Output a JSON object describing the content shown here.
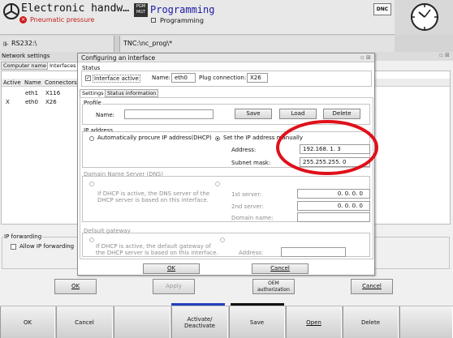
{
  "header": {
    "mode_title": "Electronic handw…",
    "mode_sub": "Pneumatic pressure",
    "pgm_badge_top": "PGM",
    "pgm_badge_bottom": "MGT",
    "prog_title": "Programming",
    "prog_sub": "Programming",
    "dnc_label": "DNC"
  },
  "path_bar": {
    "left": "RS232:\\",
    "right": "TNC:\\nc_prog\\*"
  },
  "network": {
    "title": "Network settings",
    "tabs": [
      "Computer name",
      "Interfaces"
    ],
    "columns": [
      "Active",
      "Name",
      "Connectors"
    ],
    "rows": [
      {
        "active": "",
        "name": "eth1",
        "conn": "X116"
      },
      {
        "active": "X",
        "name": "eth0",
        "conn": "X26"
      }
    ],
    "ip_forwarding_title": "IP forwarding",
    "allow_ip_forwarding": "Allow IP forwarding"
  },
  "dialog": {
    "title": "Configuring an interface",
    "status_title": "Status",
    "interface_active": "Interface active",
    "name_label": "Name:",
    "name_value": "eth0",
    "plug_label": "Plug connection:",
    "plug_value": "X26",
    "tabs": [
      "Settings",
      "Status information"
    ],
    "profile_title": "Profile",
    "profile_name_label": "Name:",
    "save": "Save",
    "load": "Load",
    "delete": "Delete",
    "ip_title": "IP address",
    "dhcp_option": "Automatically procure IP address(DHCP)",
    "manual_option": "Set the IP address manually",
    "address_label": "Address:",
    "address_value": "192.168.  1.  3",
    "subnet_label": "Subnet mask:",
    "subnet_value": "255.255.255.  0",
    "dns_title": "Domain Name Server (DNS)",
    "dns_note1": "If DHCP is active, the DNS server of the",
    "dns_note2": "DHCP server is based on this interface.",
    "server1_label": "1st server:",
    "server1_value": "0.  0.  0.  0",
    "server2_label": "2nd server:",
    "server2_value": "0.  0.  0.  0",
    "domain_label": "Domain name:",
    "gateway_title": "Default gateway",
    "gw_note1": "If DHCP is active, the default gateway of",
    "gw_note2": "the DHCP server is based on this interface.",
    "gw_address_label": "Address:",
    "ok": "OK",
    "cancel": "Cancel"
  },
  "bottom_buttons": {
    "ok": "OK",
    "apply": "Apply",
    "oem_line1": "OEM",
    "oem_line2": "authorization",
    "cancel": "Cancel"
  },
  "softkeys": [
    {
      "line1": "OK",
      "line2": ""
    },
    {
      "line1": "Cancel",
      "line2": ""
    },
    {
      "line1": "",
      "line2": ""
    },
    {
      "line1": "Activate/",
      "line2": "Deactivate"
    },
    {
      "line1": "Save",
      "line2": ""
    },
    {
      "line1": "Open",
      "line2": ""
    },
    {
      "line1": "Delete",
      "line2": ""
    },
    {
      "line1": "",
      "line2": ""
    }
  ],
  "colors": {
    "accent_blue": "#1a1aa8",
    "highlight_red": "#e0101a"
  }
}
